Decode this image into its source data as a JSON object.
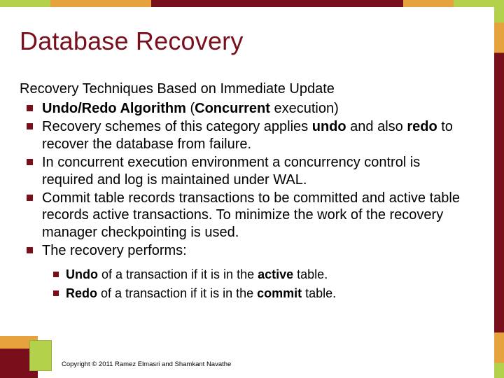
{
  "title": "Database Recovery",
  "subtitle": "Recovery Techniques Based on Immediate Update",
  "bullets": [
    {
      "pre": "",
      "b1": "Undo/Redo Algorithm",
      "mid": " (",
      "b2": "Concurrent",
      "post": " execution)"
    },
    {
      "pre": "Recovery schemes of this category applies ",
      "b1": "undo",
      "mid": " and also ",
      "b2": "redo",
      "post": " to recover the database from failure."
    },
    {
      "pre": " In concurrent execution environment a concurrency control is required and log is maintained under WAL.",
      "b1": "",
      "mid": "",
      "b2": "",
      "post": ""
    },
    {
      "pre": "Commit table records transactions to be committed and active table records active transactions.  To minimize the work of the recovery manager checkpointing is used.",
      "b1": "",
      "mid": "",
      "b2": "",
      "post": ""
    },
    {
      "pre": "The recovery performs:",
      "b1": "",
      "mid": "",
      "b2": "",
      "post": ""
    }
  ],
  "sub_bullets": [
    {
      "b1": "Undo",
      "mid": " of a transaction if it is in the ",
      "b2": "active",
      "post": " table."
    },
    {
      "b1": "Redo",
      "mid": " of a transaction if it is in the ",
      "b2": "commit",
      "post": " table."
    }
  ],
  "footer": "Copyright © 2011 Ramez Elmasri and Shamkant Navathe"
}
